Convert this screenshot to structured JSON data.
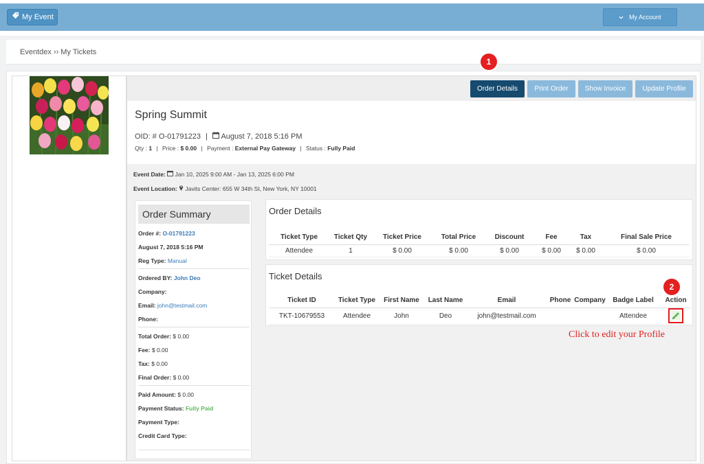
{
  "topbar": {
    "brand_label": "My Event",
    "account_label": "My Account",
    "bar_color": "#79aed4"
  },
  "breadcrumb": "Eventdex ›› My Tickets",
  "toolbar": {
    "order_details": "Order Details",
    "print_order": "Print Order",
    "show_invoice": "Show Invoice",
    "update_profile": "Update Profile"
  },
  "markers": {
    "one": "1",
    "two": "2"
  },
  "event": {
    "title": "Spring Summit",
    "oid_prefix": "OID: # ",
    "oid": "O-01791223",
    "order_datetime": "August 7, 2018 5:16 PM",
    "qty_label": "Qty : ",
    "qty": "1",
    "price_label": "Price : ",
    "price": "$ 0.00",
    "payment_label": "Payment : ",
    "payment": "External Pay Gateway",
    "status_label": "Status : ",
    "status": "Fully Paid",
    "date_label": "Event Date:",
    "date_value": "Jan 10, 2025 9:00 AM -  Jan 13, 2025 6:00 PM",
    "location_label": "Event Location:",
    "location_value": "Javits Center:  655 W 34th St,  New York, NY 10001"
  },
  "summary": {
    "heading": "Order Summary",
    "order_no_label": "Order #:",
    "order_no": "O-01791223",
    "order_date": "August 7, 2018 5:16 PM",
    "reg_type_label": "Reg Type:",
    "reg_type": "Manual",
    "ordered_by_label": "Ordered BY:",
    "ordered_by": "John Deo",
    "company_label": "Company:",
    "email_label": "Email:",
    "email": "john@testmail.com",
    "phone_label": "Phone:",
    "total_order_label": "Total Order:",
    "total_order": "$ 0.00",
    "fee_label": "Fee:",
    "fee": "$ 0.00",
    "tax_label": "Tax:",
    "tax": "$ 0.00",
    "final_order_label": "Final Order:",
    "final_order": "$ 0.00",
    "paid_amount_label": "Paid Amount:",
    "paid_amount": "$ 0.00",
    "payment_status_label": "Payment Status:",
    "payment_status": "Fully Paid",
    "payment_type_label": "Payment Type:",
    "credit_card_type_label": "Credit Card Type:"
  },
  "order_details": {
    "title": "Order Details",
    "headers": [
      "Ticket Type",
      "Ticket Qty",
      "Ticket Price",
      "Total Price",
      "Discount",
      "Fee",
      "Tax",
      "Final Sale Price"
    ],
    "rows": [
      [
        "Attendee",
        "1",
        "$ 0.00",
        "$ 0.00",
        "$ 0.00",
        "$ 0.00",
        "$ 0.00",
        "$ 0.00"
      ]
    ]
  },
  "ticket_details": {
    "title": "Ticket Details",
    "headers": [
      "Ticket ID",
      "Ticket Type",
      "First Name",
      "Last Name",
      "Email",
      "Phone",
      "Company",
      "Badge Label",
      "Action"
    ],
    "rows": [
      [
        "TKT-10679553",
        "Attendee",
        "John",
        "Deo",
        "john@testmail.com",
        "",
        "",
        "Attendee"
      ]
    ]
  },
  "hint": "Click to edit your Profile",
  "icons": [
    "tag-icon",
    "chevron-down-icon",
    "calendar-icon",
    "map-marker-icon",
    "pencil-icon"
  ]
}
